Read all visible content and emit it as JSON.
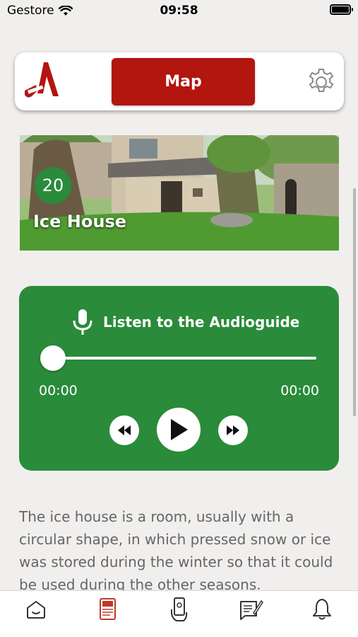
{
  "status_bar": {
    "carrier": "Gestore",
    "time": "09:58"
  },
  "header": {
    "map_label": "Map",
    "accent_color": "#b3150f"
  },
  "hero": {
    "number": "20",
    "title": "Ice House"
  },
  "audio": {
    "title": "Listen to the Audioguide",
    "current_time": "00:00",
    "total_time": "00:00",
    "progress": 0,
    "card_color": "#2a8b3a"
  },
  "description": "The ice house is a room, usually with a circular shape, in which pressed snow or ice was stored during the winter so that it could be used during the other seasons.",
  "tabs": [
    {
      "icon": "home-icon",
      "active": false
    },
    {
      "icon": "guide-book-icon",
      "active": true
    },
    {
      "icon": "phone-hand-icon",
      "active": false
    },
    {
      "icon": "notes-pen-icon",
      "active": false
    },
    {
      "icon": "bell-icon",
      "active": false
    }
  ]
}
